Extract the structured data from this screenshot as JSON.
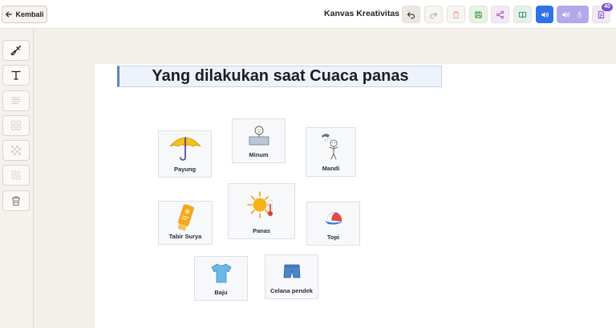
{
  "topbar": {
    "back_label": "Kembali",
    "title": "Kanvas Kreativitas",
    "notes_badge": "40",
    "accent_color": "#2f73e8"
  },
  "sidebar": {
    "tools": [
      "brush-icon",
      "text-icon",
      "paragraph-icon",
      "grid-icon",
      "pattern-icon",
      "texture-icon",
      "trash-icon"
    ]
  },
  "canvas": {
    "title": "Yang dilakukan saat Cuaca panas",
    "cards": [
      {
        "label": "Payung",
        "icon": "umbrella-icon"
      },
      {
        "label": "Minum",
        "icon": "drinking-icon"
      },
      {
        "label": "Mandi",
        "icon": "shower-icon"
      },
      {
        "label": "Tabir Surya",
        "icon": "sunscreen-icon"
      },
      {
        "label": "Panas",
        "icon": "hot-sun-icon"
      },
      {
        "label": "Topi",
        "icon": "cap-icon"
      },
      {
        "label": "Baju",
        "icon": "tshirt-icon"
      },
      {
        "label": "Celana pendek",
        "icon": "shorts-icon"
      }
    ]
  }
}
